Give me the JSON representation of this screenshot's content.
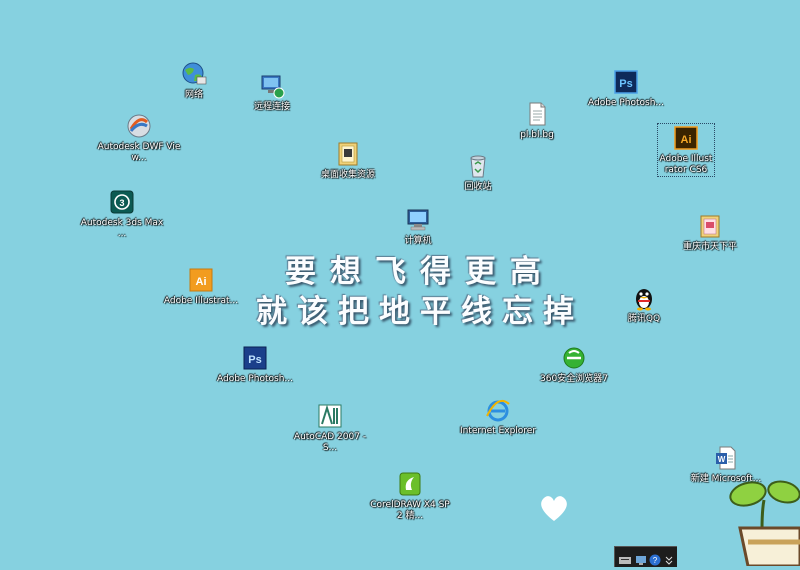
{
  "desktop": {
    "background": "#86d1e0",
    "icons": [
      {
        "name": "network",
        "label": "网络",
        "icon": "network-globe-icon"
      },
      {
        "name": "remote-desktop",
        "label": "远程连接",
        "icon": "remote-desktop-icon"
      },
      {
        "name": "autodesk-dwf",
        "label": "Autodesk DWF View...",
        "icon": "autodesk-dwf-icon"
      },
      {
        "name": "folder-collection",
        "label": "桌面收集资源",
        "icon": "folder-icon"
      },
      {
        "name": "plaintext-file",
        "label": "pl.bl.bg",
        "icon": "text-file-icon"
      },
      {
        "name": "photoshop-top",
        "label": "Adobe Photosh...",
        "icon": "photoshop-icon"
      },
      {
        "name": "illustrator-cs6",
        "label": "Adobe Illustrator CS6",
        "icon": "illustrator-icon"
      },
      {
        "name": "recycle-bin",
        "label": "回收站",
        "icon": "recycle-bin-icon"
      },
      {
        "name": "autodesk-3dsmax",
        "label": "Autodesk 3ds Max ...",
        "icon": "3dsmax-icon"
      },
      {
        "name": "computer",
        "label": "计算机",
        "icon": "computer-icon"
      },
      {
        "name": "folder-right",
        "label": "重庆市天下平",
        "icon": "folder-docs-icon"
      },
      {
        "name": "illustrator-left",
        "label": "Adobe Illustrat...",
        "icon": "illustrator-icon"
      },
      {
        "name": "qq",
        "label": "腾讯QQ",
        "icon": "qq-penguin-icon"
      },
      {
        "name": "photoshop-left",
        "label": "Adobe Photosh...",
        "icon": "photoshop-icon"
      },
      {
        "name": "360-browser",
        "label": "360安全浏览器7",
        "icon": "browser-360-icon"
      },
      {
        "name": "autocad",
        "label": "AutoCAD 2007 - S...",
        "icon": "autocad-icon"
      },
      {
        "name": "internet-explorer",
        "label": "Internet Explorer",
        "icon": "internet-explorer-icon"
      },
      {
        "name": "word-doc",
        "label": "新建 Microsoft...",
        "icon": "word-document-icon"
      },
      {
        "name": "coreldraw",
        "label": "CorelDRAW X4 SP2 精...",
        "icon": "coreldraw-icon"
      }
    ]
  },
  "wallpaper": {
    "line1": "要想飞得更高",
    "line2": "就该把地平线忘掉"
  },
  "colors": {
    "photoshop": "#1b3f8a",
    "illustrator": "#f29c1f",
    "word": "#2b5faa"
  }
}
